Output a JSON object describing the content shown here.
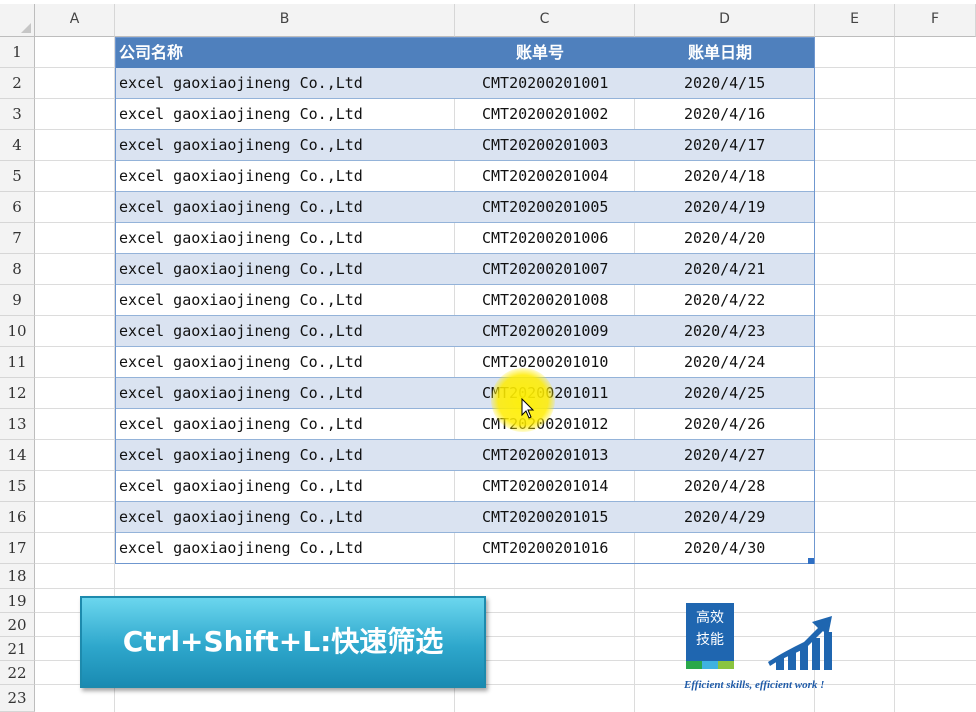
{
  "columns": [
    "A",
    "B",
    "C",
    "D",
    "E",
    "F"
  ],
  "rows": [
    "1",
    "2",
    "3",
    "4",
    "5",
    "6",
    "7",
    "8",
    "9",
    "10",
    "11",
    "12",
    "13",
    "14",
    "15",
    "16",
    "17",
    "18",
    "19",
    "20",
    "21",
    "22",
    "23"
  ],
  "table": {
    "headers": [
      "公司名称",
      "账单号",
      "账单日期"
    ],
    "records": [
      [
        "excel gaoxiaojineng Co.,Ltd",
        "CMT20200201001",
        "2020/4/15"
      ],
      [
        "excel gaoxiaojineng Co.,Ltd",
        "CMT20200201002",
        "2020/4/16"
      ],
      [
        "excel gaoxiaojineng Co.,Ltd",
        "CMT20200201003",
        "2020/4/17"
      ],
      [
        "excel gaoxiaojineng Co.,Ltd",
        "CMT20200201004",
        "2020/4/18"
      ],
      [
        "excel gaoxiaojineng Co.,Ltd",
        "CMT20200201005",
        "2020/4/19"
      ],
      [
        "excel gaoxiaojineng Co.,Ltd",
        "CMT20200201006",
        "2020/4/20"
      ],
      [
        "excel gaoxiaojineng Co.,Ltd",
        "CMT20200201007",
        "2020/4/21"
      ],
      [
        "excel gaoxiaojineng Co.,Ltd",
        "CMT20200201008",
        "2020/4/22"
      ],
      [
        "excel gaoxiaojineng Co.,Ltd",
        "CMT20200201009",
        "2020/4/23"
      ],
      [
        "excel gaoxiaojineng Co.,Ltd",
        "CMT20200201010",
        "2020/4/24"
      ],
      [
        "excel gaoxiaojineng Co.,Ltd",
        "CMT20200201011",
        "2020/4/25"
      ],
      [
        "excel gaoxiaojineng Co.,Ltd",
        "CMT20200201012",
        "2020/4/26"
      ],
      [
        "excel gaoxiaojineng Co.,Ltd",
        "CMT20200201013",
        "2020/4/27"
      ],
      [
        "excel gaoxiaojineng Co.,Ltd",
        "CMT20200201014",
        "2020/4/28"
      ],
      [
        "excel gaoxiaojineng Co.,Ltd",
        "CMT20200201015",
        "2020/4/29"
      ],
      [
        "excel gaoxiaojineng Co.,Ltd",
        "CMT20200201016",
        "2020/4/30"
      ]
    ]
  },
  "banner": {
    "text": "Ctrl+Shift+L:快速筛选"
  },
  "logo": {
    "line1": "高效",
    "line2": "技能",
    "tagline": "Efficient skills, efficient work !",
    "stripe_colors": [
      "#2aa84a",
      "#3fb2e0",
      "#8ac43f"
    ],
    "chart_icon": "growth-chart-icon"
  },
  "colors": {
    "header_fill": "#4f80bd",
    "band_fill": "#dae3f1",
    "banner_fill": "#2ea7cc",
    "logo_blue": "#1f66b0"
  },
  "cursor": {
    "icon": "mouse-pointer-icon",
    "highlight": "yellow-click-highlight"
  }
}
